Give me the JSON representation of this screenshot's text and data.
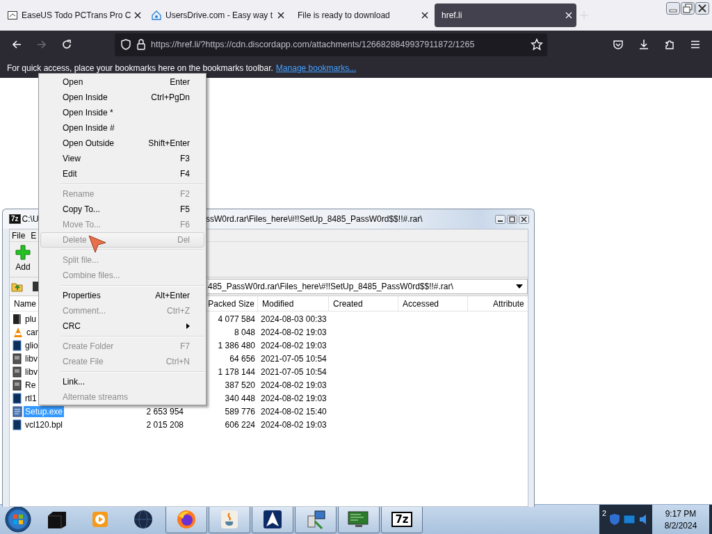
{
  "browser": {
    "tabs": [
      {
        "title": "EaseUS Todo PCTrans Pro C",
        "kind": "document",
        "selected": false
      },
      {
        "title": "UsersDrive.com - Easy way t",
        "kind": "cloud",
        "selected": false
      },
      {
        "title": "File is ready to download",
        "kind": "plain",
        "selected": false
      },
      {
        "title": "href.li",
        "kind": "plain",
        "selected": true
      }
    ],
    "forward_disabled": true,
    "url": "https://href.li/?https://cdn.discordapp.com/attachments/1266828849937911872/1265",
    "bookmarks_text": "For quick access, place your bookmarks here on the bookmarks toolbar.",
    "bookmarks_link": "Manage bookmarks..."
  },
  "archive_window": {
    "icon_text": "7z",
    "title_start": "C:\\U",
    "title_end": "ssW0rd.rar\\Files_here\\#!!SetUp_8485_PassW0rd$$!!#.rar\\",
    "menu": [
      "File",
      "E"
    ],
    "toolbar": [
      {
        "label": "Add"
      }
    ],
    "path": "485_PassW0rd.rar\\Files_here\\#!!SetUp_8485_PassW0rd$$!!#.rar\\",
    "columns": [
      "Name",
      "Packed Size",
      "Modified",
      "Created",
      "Accessed",
      "Attribute"
    ],
    "rows": [
      {
        "kind": "dark",
        "name": "plu",
        "packed": "4 077 584",
        "modified": "2024-08-03 00:33",
        "selected": false
      },
      {
        "kind": "cone",
        "name": "car",
        "packed": "8 048",
        "modified": "2024-08-02 19:03",
        "selected": false
      },
      {
        "kind": "blue",
        "name": "glio",
        "packed": "1 386 480",
        "modified": "2024-08-02 19:03",
        "selected": false
      },
      {
        "kind": "gray",
        "name": "libv",
        "packed": "64 656",
        "modified": "2021-07-05 10:54",
        "selected": false
      },
      {
        "kind": "gray",
        "name": "libv",
        "packed": "1 178 144",
        "modified": "2021-07-05 10:54",
        "selected": false
      },
      {
        "kind": "gray",
        "name": "Re",
        "packed": "387 520",
        "modified": "2024-08-02 19:03",
        "selected": false
      },
      {
        "kind": "blue",
        "name": "rtl1",
        "packed": "340 448",
        "modified": "2024-08-02 19:03",
        "selected": false
      },
      {
        "kind": "setup",
        "name": "Setup.exe",
        "size": "2 653 954",
        "packed": "589 776",
        "modified": "2024-08-02 15:40",
        "selected": true
      },
      {
        "kind": "blue",
        "name": "vcl120.bpl",
        "size": "2 015 208",
        "packed": "606 224",
        "modified": "2024-08-02 19:03",
        "selected": false
      }
    ]
  },
  "context_menu": [
    {
      "kind": "item",
      "label": "Open",
      "shortcut": "Enter",
      "disabled": false,
      "selected": false
    },
    {
      "kind": "item",
      "label": "Open Inside",
      "shortcut": "Ctrl+PgDn",
      "disabled": false,
      "selected": false
    },
    {
      "kind": "item",
      "label": "Open Inside *",
      "disabled": false,
      "selected": false
    },
    {
      "kind": "item",
      "label": "Open Inside #",
      "disabled": false,
      "selected": false
    },
    {
      "kind": "item",
      "label": "Open Outside",
      "shortcut": "Shift+Enter",
      "disabled": false,
      "selected": false
    },
    {
      "kind": "item",
      "label": "View",
      "shortcut": "F3",
      "disabled": false,
      "selected": false
    },
    {
      "kind": "item",
      "label": "Edit",
      "shortcut": "F4",
      "disabled": false,
      "selected": false
    },
    {
      "kind": "separator"
    },
    {
      "kind": "item",
      "label": "Rename",
      "shortcut": "F2",
      "disabled": true,
      "selected": false
    },
    {
      "kind": "item",
      "label": "Copy To...",
      "shortcut": "F5",
      "disabled": false,
      "selected": false
    },
    {
      "kind": "item",
      "label": "Move To...",
      "shortcut": "F6",
      "disabled": true,
      "selected": false
    },
    {
      "kind": "item",
      "label": "Delete",
      "shortcut": "Del",
      "disabled": true,
      "selected": true
    },
    {
      "kind": "separator"
    },
    {
      "kind": "item",
      "label": "Split file...",
      "disabled": true,
      "selected": false
    },
    {
      "kind": "item",
      "label": "Combine files...",
      "disabled": true,
      "selected": false
    },
    {
      "kind": "separator"
    },
    {
      "kind": "item",
      "label": "Properties",
      "shortcut": "Alt+Enter",
      "disabled": false,
      "selected": false
    },
    {
      "kind": "item",
      "label": "Comment...",
      "shortcut": "Ctrl+Z",
      "disabled": true,
      "selected": false
    },
    {
      "kind": "item",
      "label": "CRC",
      "submenu": true,
      "disabled": false,
      "selected": false
    },
    {
      "kind": "separator"
    },
    {
      "kind": "item",
      "label": "Create Folder",
      "shortcut": "F7",
      "disabled": true,
      "selected": false
    },
    {
      "kind": "item",
      "label": "Create File",
      "shortcut": "Ctrl+N",
      "disabled": true,
      "selected": false
    },
    {
      "kind": "separator"
    },
    {
      "kind": "item",
      "label": "Link...",
      "disabled": false,
      "selected": false
    },
    {
      "kind": "item",
      "label": "Alternate streams",
      "disabled": true,
      "selected": false
    }
  ],
  "taskbar": {
    "apps": [
      {
        "kind": "box",
        "running": false
      },
      {
        "kind": "player",
        "running": false
      },
      {
        "kind": "globe",
        "running": false
      },
      {
        "kind": "firefox",
        "running": true
      },
      {
        "kind": "java",
        "running": true
      },
      {
        "kind": "arrow",
        "running": true
      },
      {
        "kind": "network",
        "running": true
      },
      {
        "kind": "monitor",
        "running": true
      },
      {
        "kind": "sevenzip",
        "running": true,
        "label": "7z"
      }
    ],
    "tray_count": "2",
    "time": "9:17 PM",
    "date": "8/2/2024"
  }
}
